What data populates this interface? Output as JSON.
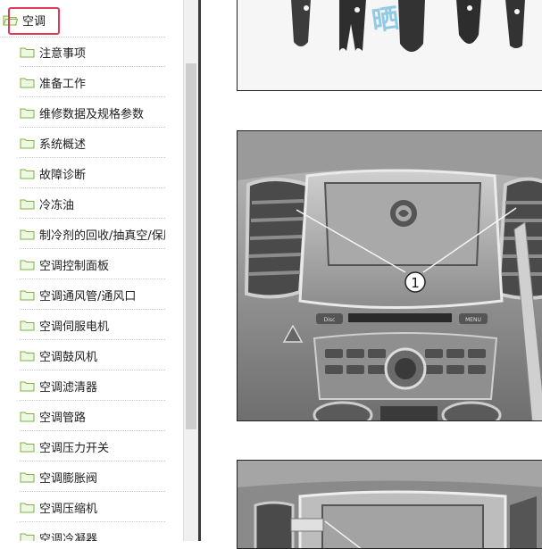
{
  "tree": {
    "root": {
      "label": "空调",
      "icon": "folder-open-icon"
    },
    "items": [
      {
        "label": "注意事项"
      },
      {
        "label": "准备工作"
      },
      {
        "label": "维修数据及规格参数"
      },
      {
        "label": "系统概述"
      },
      {
        "label": "故障诊断"
      },
      {
        "label": "冷冻油"
      },
      {
        "label": "制冷剂的回收/抽真空/保压/充"
      },
      {
        "label": "空调控制面板"
      },
      {
        "label": "空调通风管/通风口"
      },
      {
        "label": "空调伺服电机"
      },
      {
        "label": "空调鼓风机"
      },
      {
        "label": "空调滤清器"
      },
      {
        "label": "空调管路"
      },
      {
        "label": "空调压力开关"
      },
      {
        "label": "空调膨胀阀"
      },
      {
        "label": "空调压缩机"
      },
      {
        "label": "空调冷凝器"
      }
    ]
  },
  "document": {
    "watermark": "晒",
    "callout_number": "1",
    "panel_buttons": [
      "Disc",
      "MENU"
    ],
    "accent_color": "#e43a57"
  }
}
